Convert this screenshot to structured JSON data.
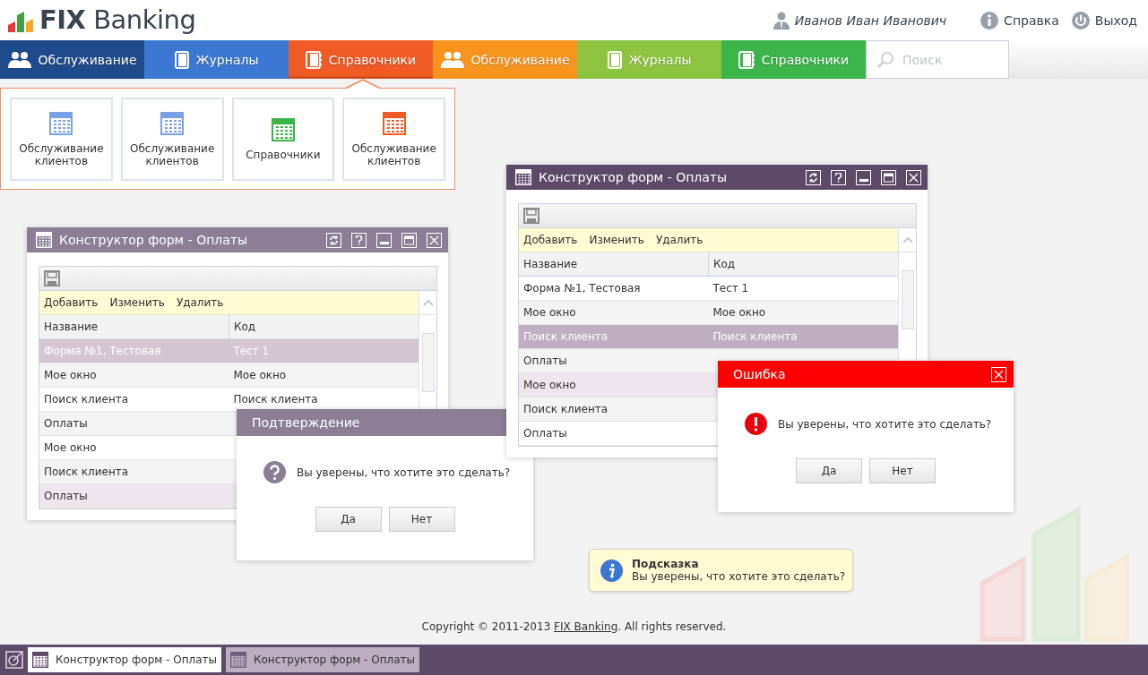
{
  "header": {
    "logo": "**FIX** Banking",
    "user": "Иванов Иван Иванович",
    "links": [
      {
        "kind": "help",
        "label": "Справка"
      },
      {
        "kind": "logout",
        "label": "Выход"
      }
    ]
  },
  "nav": {
    "tabs": [
      {
        "kind": "service",
        "label": "Обслуживание",
        "color": "#1d4b8c",
        "selected": false
      },
      {
        "kind": "journals",
        "label": "Журналы",
        "color": "#3c78d3",
        "selected": false
      },
      {
        "kind": "directories",
        "label": "Справочники",
        "color": "#f05a24",
        "selected": true
      },
      {
        "kind": "service",
        "label": "Обслуживание",
        "color": "#f7941e",
        "selected": false
      },
      {
        "kind": "journals",
        "label": "Журналы",
        "color": "#8dc43f",
        "selected": false
      },
      {
        "kind": "directories",
        "label": "Справочники",
        "color": "#3bb44a",
        "selected": false
      }
    ],
    "search": {
      "placeholder": "Поиск"
    }
  },
  "menu": {
    "tiles": [
      {
        "label": "Обслуживание клиентов",
        "color": "#7aa1e6"
      },
      {
        "label": "Обслуживание клиентов",
        "color": "#7aa1e6"
      },
      {
        "label": "Справочники",
        "color": "#3bb44a"
      },
      {
        "label": "Обслуживание клиентов",
        "color": "#f05a24"
      }
    ]
  },
  "windows": [
    {
      "title": "Конструктор форм - Оплаты",
      "active": false,
      "actions": [
        "Добавить",
        "Изменить",
        "Удалить"
      ],
      "columns": [
        "Название",
        "Код"
      ],
      "rows": [
        {
          "name": "Форма №1, Тестовая",
          "code": "Тест 1",
          "selected": true,
          "highlighted": false
        },
        {
          "name": "Мое окно",
          "code": "Мое окно",
          "selected": false,
          "highlighted": false
        },
        {
          "name": "Поиск клиента",
          "code": "Поиск клиента",
          "selected": false,
          "highlighted": false
        },
        {
          "name": "Оплаты",
          "selected": false,
          "highlighted": false
        },
        {
          "name": "Мое окно",
          "selected": false,
          "highlighted": false
        },
        {
          "name": "Поиск клиента",
          "selected": false,
          "highlighted": false
        },
        {
          "name": "Оплаты",
          "selected": false,
          "highlighted": true
        }
      ]
    },
    {
      "title": "Конструктор форм - Оплаты",
      "active": true,
      "actions": [
        "Добавить",
        "Изменить",
        "Удалить"
      ],
      "columns": [
        "Название",
        "Код"
      ],
      "rows": [
        {
          "name": "Форма №1, Тестовая",
          "code": "Тест 1",
          "selected": false,
          "highlighted": false
        },
        {
          "name": "Мое окно",
          "code": "Мое окно",
          "selected": false,
          "highlighted": false
        },
        {
          "name": "Поиск клиента",
          "code": "Поиск клиента",
          "selected": true,
          "highlighted": false
        },
        {
          "name": "Оплаты",
          "selected": false,
          "highlighted": false
        },
        {
          "name": "Мое окно",
          "selected": false,
          "highlighted": true
        },
        {
          "name": "Поиск клиента",
          "selected": false,
          "highlighted": false
        },
        {
          "name": "Оплаты",
          "selected": false,
          "highlighted": false
        }
      ]
    }
  ],
  "dialogs": [
    {
      "kind": "confirm",
      "title": "Подтверждение",
      "message": "Вы уверены, что хотите это сделать?",
      "buttons": [
        "Да",
        "Нет"
      ]
    },
    {
      "kind": "error",
      "title": "Ошибка",
      "message": "Вы уверены, что хотите это сделать?",
      "buttons": [
        "Да",
        "Нет"
      ]
    }
  ],
  "tooltip": {
    "title": "Подсказка",
    "message": "Вы уверены, что хотите это сделать?"
  },
  "footer": {
    "before": "Copyright © 2011-2013 ",
    "link": "FIX Banking",
    "after": ". All rights reserved."
  },
  "taskbar": {
    "tasks": [
      {
        "label": "Конструктор форм - Оплаты",
        "selected": true
      },
      {
        "label": "Конструктор форм - Оплаты",
        "selected": false
      }
    ]
  }
}
